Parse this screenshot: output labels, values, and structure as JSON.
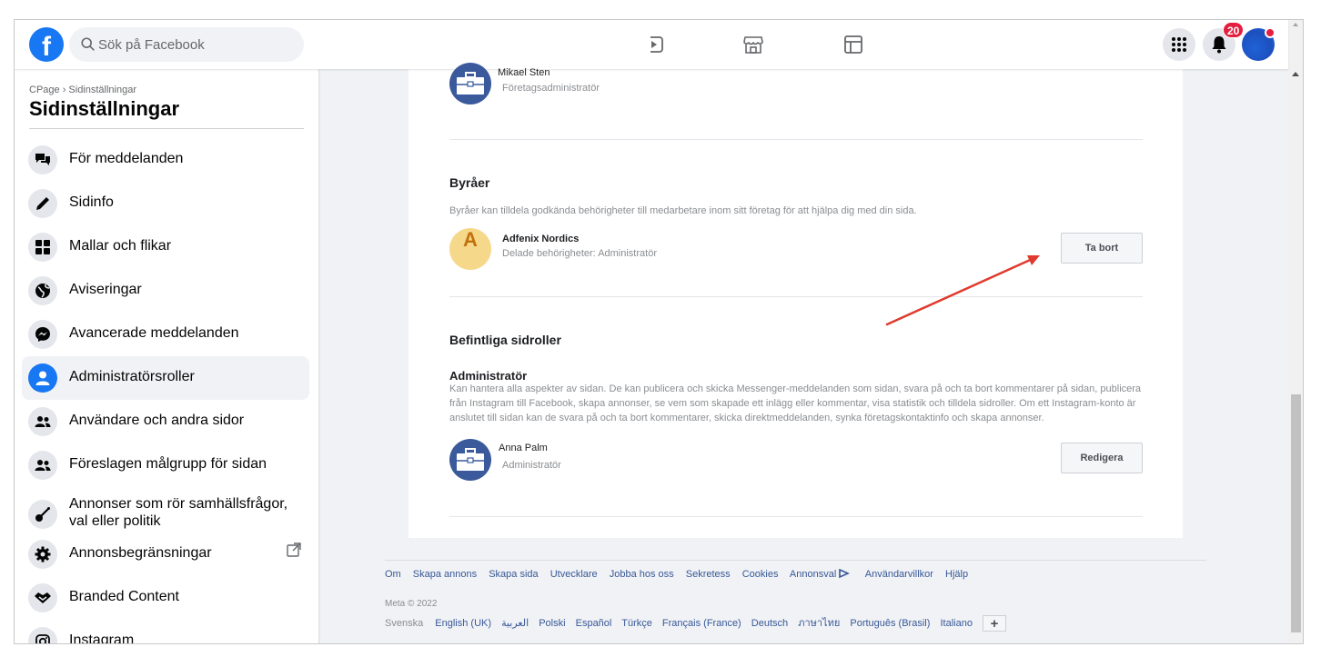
{
  "topbar": {
    "logo": "f",
    "search_placeholder": "Sök på Facebook",
    "nav_icons": [
      "home-icon",
      "friends-icon",
      "watch-icon",
      "marketplace-icon",
      "pages-icon"
    ],
    "notification_count": "20"
  },
  "sidebar": {
    "breadcrumb": "CPage › Sidinställningar",
    "title": "Sidinställningar",
    "items": [
      {
        "label": "För meddelanden",
        "icon": "chat-bubbles-icon"
      },
      {
        "label": "Sidinfo",
        "icon": "pencil-icon"
      },
      {
        "label": "Mallar och flikar",
        "icon": "grid-icon"
      },
      {
        "label": "Aviseringar",
        "icon": "globe-icon"
      },
      {
        "label": "Avancerade meddelanden",
        "icon": "messenger-icon"
      },
      {
        "label": "Administratörsroller",
        "icon": "person-icon",
        "active": true
      },
      {
        "label": "Användare och andra sidor",
        "icon": "people-icon"
      },
      {
        "label": "Föreslagen målgrupp för sidan",
        "icon": "people-icon"
      },
      {
        "label": "Annonser som rör samhällsfrågor, val eller politik",
        "icon": "guitar-icon"
      },
      {
        "label": "Annonsbegränsningar",
        "icon": "gear-icon"
      },
      {
        "label": "Branded Content",
        "icon": "handshake-icon"
      },
      {
        "label": "Instagram",
        "icon": "instagram-icon"
      }
    ]
  },
  "main": {
    "top_person": {
      "name": "Mikael Sten",
      "role": "Företagsadministratör"
    },
    "agencies": {
      "heading": "Byråer",
      "description": "Byråer kan tilldela godkända behörigheter till medarbetare inom sitt företag för att hjälpa dig med din sida.",
      "agency": {
        "initial": "A",
        "name": "Adfenix Nordics",
        "permissions": "Delade behörigheter: Administratör",
        "button": "Ta bort"
      }
    },
    "roles": {
      "heading": "Befintliga sidroller",
      "role_title": "Administratör",
      "description": "Kan hantera alla aspekter av sidan. De kan publicera och skicka Messenger-meddelanden som sidan, svara på och ta bort kommentarer på sidan, publicera från Instagram till Facebook, skapa annonser, se vem som skapade ett inlägg eller kommentar, visa statistik och tilldela sidroller. Om ett Instagram-konto är anslutet till sidan kan de svara på och ta bort kommentarer, skicka direktmeddelanden, synka företagskontaktinfo och skapa annonser.",
      "person": {
        "name": "Anna Palm",
        "role": "Administratör",
        "button": "Redigera"
      }
    }
  },
  "footer": {
    "links": [
      "Om",
      "Skapa annons",
      "Skapa sida",
      "Utvecklare",
      "Jobba hos oss",
      "Sekretess",
      "Cookies",
      "Annonsval",
      "Användarvillkor",
      "Hjälp"
    ],
    "copyright": "Meta © 2022",
    "current_language": "Svenska",
    "languages": [
      "English (UK)",
      "العربية",
      "Polski",
      "Español",
      "Türkçe",
      "Français (France)",
      "Deutsch",
      "ภาษาไทย",
      "Português (Brasil)",
      "Italiano"
    ],
    "more": "+"
  },
  "colors": {
    "brand": "#1877f2",
    "annotation_arrow": "#e03a2e",
    "badge": "#e41e3f"
  }
}
